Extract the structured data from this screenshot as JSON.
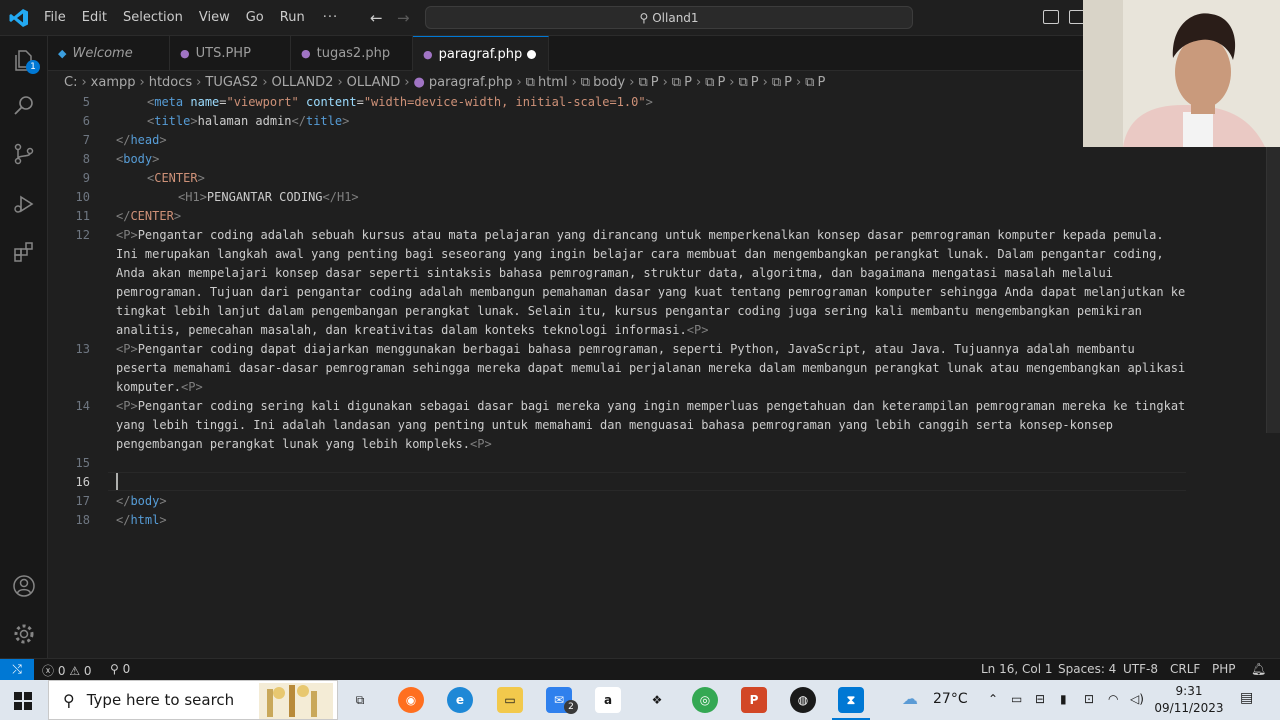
{
  "menu": [
    "File",
    "Edit",
    "Selection",
    "View",
    "Go",
    "Run",
    "···"
  ],
  "search": {
    "text": "Olland1"
  },
  "tabs": [
    {
      "label": "Welcome"
    },
    {
      "label": "UTS.PHP"
    },
    {
      "label": "tugas2.php"
    },
    {
      "label": "paragraf.php",
      "modified": true
    }
  ],
  "breadcrumb": [
    "C:",
    "xampp",
    "htdocs",
    "TUGAS2",
    "OLLAND2",
    "OLLAND",
    "paragraf.php",
    "html",
    "body",
    "P",
    "P",
    "P",
    "P",
    "P",
    "P"
  ],
  "editor": {
    "current_line": 16,
    "l5": {
      "num": "5",
      "tag_open": "<",
      "tag": "meta",
      "a1": "name",
      "eq1": "=",
      "v1": "\"viewport\"",
      "a2": "content",
      "eq2": "=",
      "v2": "\"width=device-width, initial-scale=1.0\"",
      "close": ">"
    },
    "l6": {
      "num": "6",
      "open": "<",
      "tag": "title",
      "close": ">",
      "text": "halaman admin",
      "end_open": "</",
      "end_tag": "title",
      "end_close": ">"
    },
    "l7": {
      "num": "7",
      "open": "</",
      "tag": "head",
      "close": ">"
    },
    "l8": {
      "num": "8",
      "open": "<",
      "tag": "body",
      "close": ">"
    },
    "l9": {
      "num": "9",
      "open": "<",
      "tag": "CENTER",
      "close": ">"
    },
    "l10": {
      "num": "10",
      "open": "<",
      "tag": "H1",
      "close": ">",
      "text": "PENGANTAR CODING",
      "end_open": "</",
      "end_tag": "H1",
      "end_close": ">"
    },
    "l11": {
      "num": "11",
      "open": "</",
      "tag": "CENTER",
      "close": ">"
    },
    "l12": {
      "num": "12",
      "open": "<",
      "tag": "P",
      "close": ">",
      "text": "Pengantar coding adalah sebuah kursus atau mata pelajaran yang dirancang untuk memperkenalkan konsep dasar pemrograman komputer kepada pemula. Ini merupakan langkah awal yang penting bagi seseorang yang ingin belajar cara membuat dan mengembangkan perangkat lunak. Dalam pengantar coding, Anda akan mempelajari konsep dasar seperti sintaksis bahasa pemrograman, struktur data, algoritma, dan bagaimana mengatasi masalah melalui pemrograman. Tujuan dari pengantar coding adalah membangun pemahaman dasar yang kuat tentang pemrograman komputer sehingga Anda dapat melanjutkan ke tingkat lebih lanjut dalam pengembangan perangkat lunak. Selain itu, kursus pengantar coding juga sering kali membantu mengembangkan pemikiran analitis, pemecahan masalah, dan kreativitas dalam konteks teknologi informasi."
    },
    "l13": {
      "num": "13",
      "open": "<",
      "tag": "P",
      "close": ">",
      "text": "Pengantar coding dapat diajarkan menggunakan berbagai bahasa pemrograman, seperti Python, JavaScript, atau Java. Tujuannya adalah membantu peserta memahami dasar-dasar pemrograman sehingga mereka dapat memulai perjalanan mereka dalam membangun perangkat lunak atau mengembangkan aplikasi komputer."
    },
    "l14": {
      "num": "14",
      "open": "<",
      "tag": "P",
      "close": ">",
      "text": "Pengantar coding sering kali digunakan sebagai dasar bagi mereka yang ingin memperluas pengetahuan dan keterampilan pemrograman mereka ke tingkat yang lebih tinggi. Ini adalah landasan yang penting untuk memahami dan menguasai bahasa pemrograman yang lebih canggih serta konsep-konsep pengembangan perangkat lunak yang lebih kompleks."
    },
    "l15": {
      "num": "15"
    },
    "l16": {
      "num": "16"
    },
    "l17": {
      "num": "17",
      "open": "</",
      "tag": "body",
      "close": ">"
    },
    "l18": {
      "num": "18",
      "open": "</",
      "tag": "html",
      "close": ">"
    }
  },
  "status": {
    "remote": "⤭",
    "errors": "0",
    "warnings": "0",
    "ports": "0",
    "position": "Ln 16, Col 1",
    "spaces": "Spaces: 4",
    "encoding": "UTF-8",
    "eol": "CRLF",
    "language": "PHP"
  },
  "taskbar": {
    "search_placeholder": "Type here to search",
    "mail_badge": "2",
    "weather": "27°C",
    "time": "9:31",
    "date": "09/11/2023"
  },
  "colors": {
    "accent": "#0078d4",
    "tag": "#569cd6",
    "attr": "#9cdcfe",
    "string": "#ce9178"
  }
}
